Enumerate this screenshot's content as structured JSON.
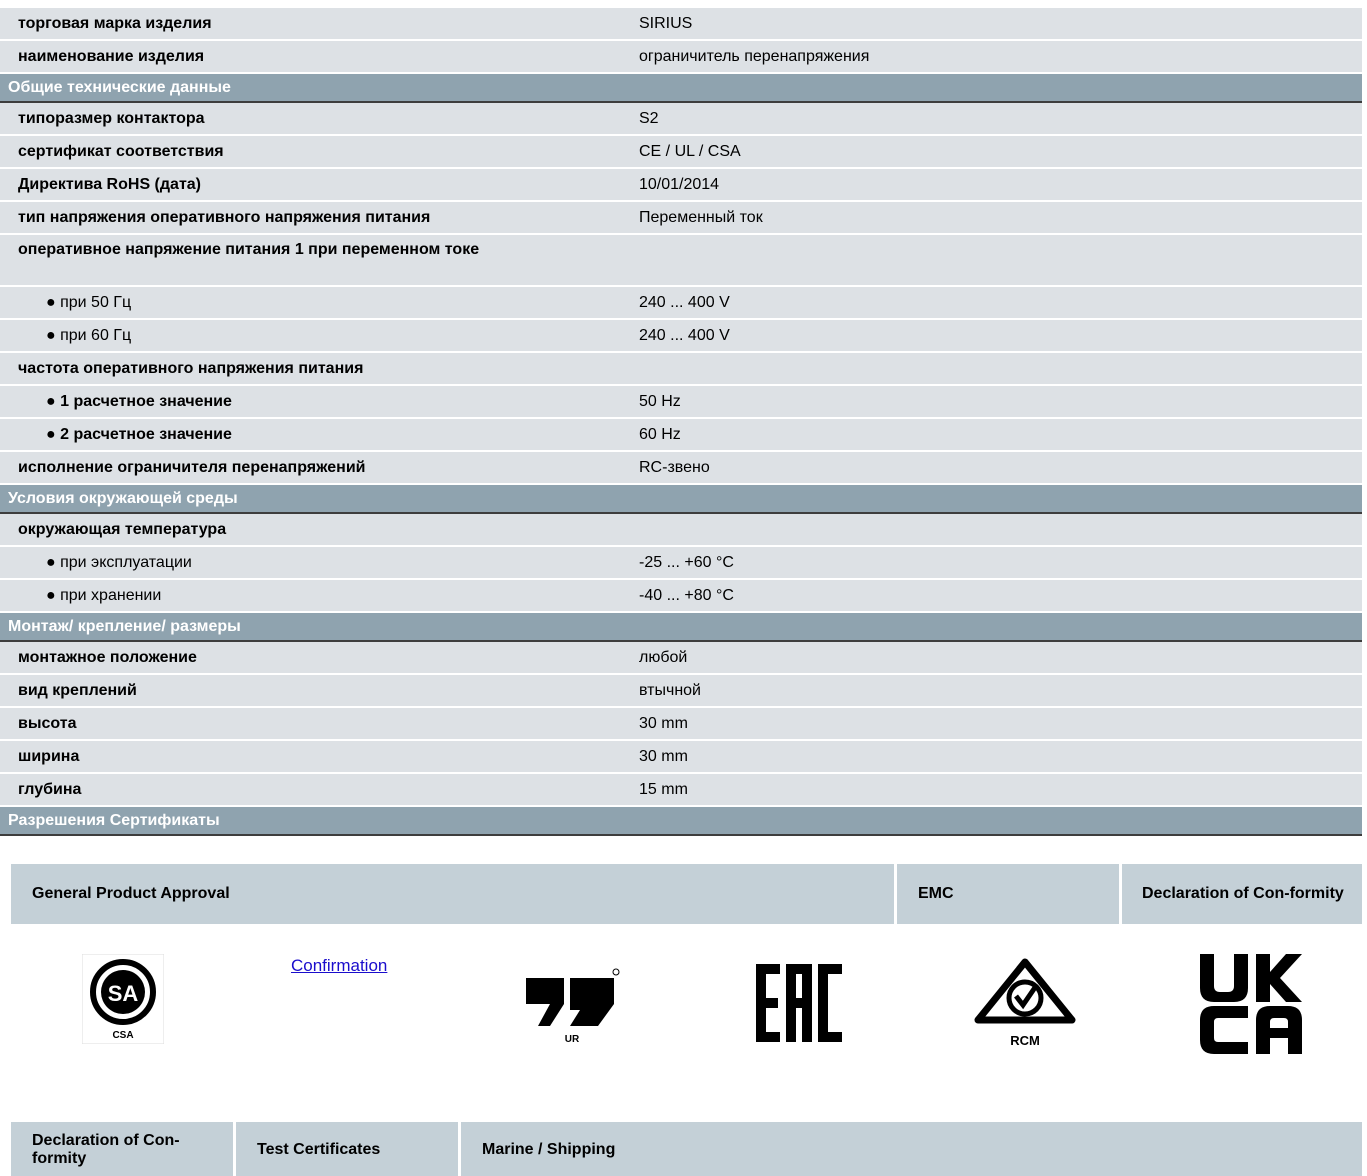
{
  "rows": [
    {
      "kind": "row",
      "label": "торговая марка изделия",
      "value": "SIRIUS"
    },
    {
      "kind": "row",
      "label": "наименование изделия",
      "value": "ограничитель перенапряжения"
    },
    {
      "kind": "sec",
      "label": "Общие технические данные"
    },
    {
      "kind": "row",
      "label": "типоразмер контактора",
      "value": "S2"
    },
    {
      "kind": "row",
      "label": "сертификат соответствия",
      "value": "CE / UL / CSA"
    },
    {
      "kind": "row",
      "label": "Директива RoHS (дата)",
      "value": "10/01/2014"
    },
    {
      "kind": "row",
      "label": "тип напряжения оперативного напряжения питания",
      "value": "Переменный ток"
    },
    {
      "kind": "row2",
      "label": "оперативное напряжение питания 1 при переменном токе",
      "value": ""
    },
    {
      "kind": "sub",
      "label": "● при 50 Гц",
      "value": "240 ... 400 V"
    },
    {
      "kind": "sub",
      "label": "● при 60 Гц",
      "value": "240 ... 400 V"
    },
    {
      "kind": "row",
      "label": "частота оперативного напряжения питания",
      "value": ""
    },
    {
      "kind": "subb",
      "label": "● 1 расчетное значение",
      "value": "50 Hz"
    },
    {
      "kind": "subb",
      "label": "● 2 расчетное значение",
      "value": "60 Hz"
    },
    {
      "kind": "row",
      "label": "исполнение ограничителя перенапряжений",
      "value": "RC-звено"
    },
    {
      "kind": "sec",
      "label": "Условия окружающей среды"
    },
    {
      "kind": "row",
      "label": "окружающая температура",
      "value": ""
    },
    {
      "kind": "sub",
      "label": "● при эксплуатации",
      "value": "-25 ... +60 °C"
    },
    {
      "kind": "sub",
      "label": "● при хранении",
      "value": "-40 ... +80 °C"
    },
    {
      "kind": "sec",
      "label": "Монтаж/ крепление/ размеры"
    },
    {
      "kind": "row",
      "label": "монтажное положение",
      "value": "любой"
    },
    {
      "kind": "row",
      "label": "вид креплений",
      "value": "втычной"
    },
    {
      "kind": "row",
      "label": "высота",
      "value": "30 mm"
    },
    {
      "kind": "row",
      "label": "ширина",
      "value": "30 mm"
    },
    {
      "kind": "row",
      "label": "глубина",
      "value": "15 mm"
    },
    {
      "kind": "sec",
      "label": "Разрешения Сертификаты"
    }
  ],
  "certs": {
    "general_product_approval": "General Product Approval",
    "emc": "EMC",
    "declaration": "Declaration of Con-formity",
    "confirmation_link": "Confirmation",
    "logos": {
      "csa": {
        "icon": "csa-logo",
        "caption": "CSA"
      },
      "ur": {
        "icon": "ur-logo",
        "caption": "UR"
      },
      "eac": {
        "icon": "eac-logo",
        "caption": "EAC"
      },
      "rcm": {
        "icon": "rcm-logo",
        "caption": "RCM"
      },
      "ukca": {
        "icon": "ukca-logo",
        "caption": "UKCA"
      }
    }
  },
  "certs2": {
    "declaration": "Declaration of Con-formity",
    "test_certificates": "Test Certificates",
    "marine": "Marine / Shipping"
  }
}
